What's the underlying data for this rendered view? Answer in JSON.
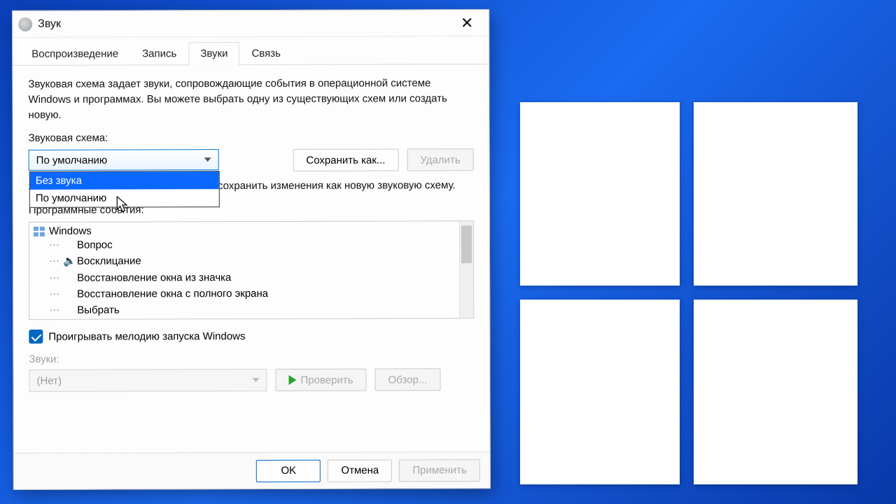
{
  "window": {
    "title": "Звук"
  },
  "tabs": {
    "playback": "Воспроизведение",
    "recording": "Запись",
    "sounds": "Звуки",
    "communications": "Связь"
  },
  "description": "Звуковая схема задает звуки, сопровождающие события в операционной системе Windows и программах. Вы можете выбрать одну из существующих схем или создать новую.",
  "scheme": {
    "label": "Звуковая схема:",
    "selected": "По умолчанию",
    "options": {
      "none": "Без звука",
      "default": "По умолчанию"
    },
    "save_as": "Сохранить как...",
    "delete": "Удалить"
  },
  "hint": "ждение, щелкните событие в списке и сохранить изменения как новую звуковую схему.",
  "events": {
    "label": "Программные события:",
    "root": "Windows",
    "items": {
      "0": "Вопрос",
      "1": "Восклицание",
      "2": "Восстановление окна из значка",
      "3": "Восстановление окна с полного экрана",
      "4": "Выбрать"
    }
  },
  "startup_checkbox": "Проигрывать мелодию запуска Windows",
  "sound": {
    "label": "Звуки:",
    "value": "(Нет)",
    "test": "Проверить",
    "browse": "Обзор..."
  },
  "footer": {
    "ok": "OK",
    "cancel": "Отмена",
    "apply": "Применить"
  }
}
